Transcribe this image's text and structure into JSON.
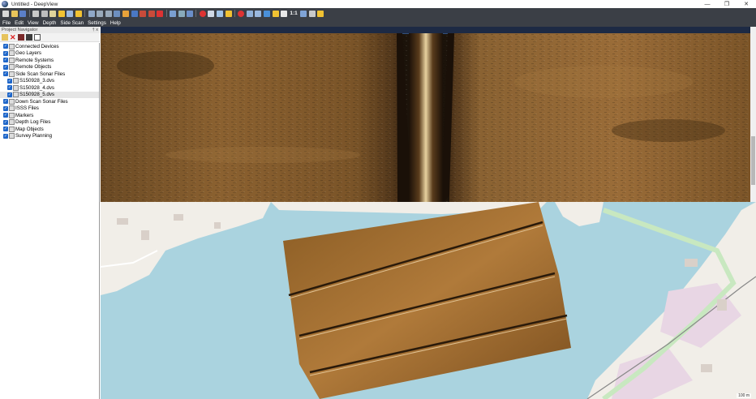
{
  "window": {
    "title": "Untitled - DeepView",
    "controls": [
      "—",
      "❐",
      "✕"
    ]
  },
  "toolbar": {
    "one_to_one_label": "1:1"
  },
  "menu": [
    "File",
    "Edit",
    "View",
    "Depth",
    "Side Scan",
    "Settings",
    "Help"
  ],
  "project_navigator": {
    "header": "Project Navigator",
    "pin": "† x",
    "tree": [
      {
        "label": "Connected Devices",
        "level": 0
      },
      {
        "label": "Geo Layers",
        "level": 0
      },
      {
        "label": "Remote Systems",
        "level": 0
      },
      {
        "label": "Remote Objects",
        "level": 0
      },
      {
        "label": "Side Scan Sonar Files",
        "level": 0
      },
      {
        "label": "S150928_3.dvs",
        "level": 1
      },
      {
        "label": "S150928_4.dvs",
        "level": 1
      },
      {
        "label": "S150928_5.dvs",
        "level": 1,
        "selected": true
      },
      {
        "label": "Down Scan Sonar Files",
        "level": 0
      },
      {
        "label": "ISSS Files",
        "level": 0
      },
      {
        "label": "Markers",
        "level": 0
      },
      {
        "label": "Depth Log Files",
        "level": 0
      },
      {
        "label": "Map Objects",
        "level": 0
      },
      {
        "label": "Survey Planning",
        "level": 0
      }
    ]
  },
  "map": {
    "scale_label": "100 m"
  },
  "colors": {
    "toolbar_bg": "#3b3f46",
    "checkbox": "#1e66c9",
    "water": "#aad3df",
    "sonar_gold": "#b07a3a"
  }
}
